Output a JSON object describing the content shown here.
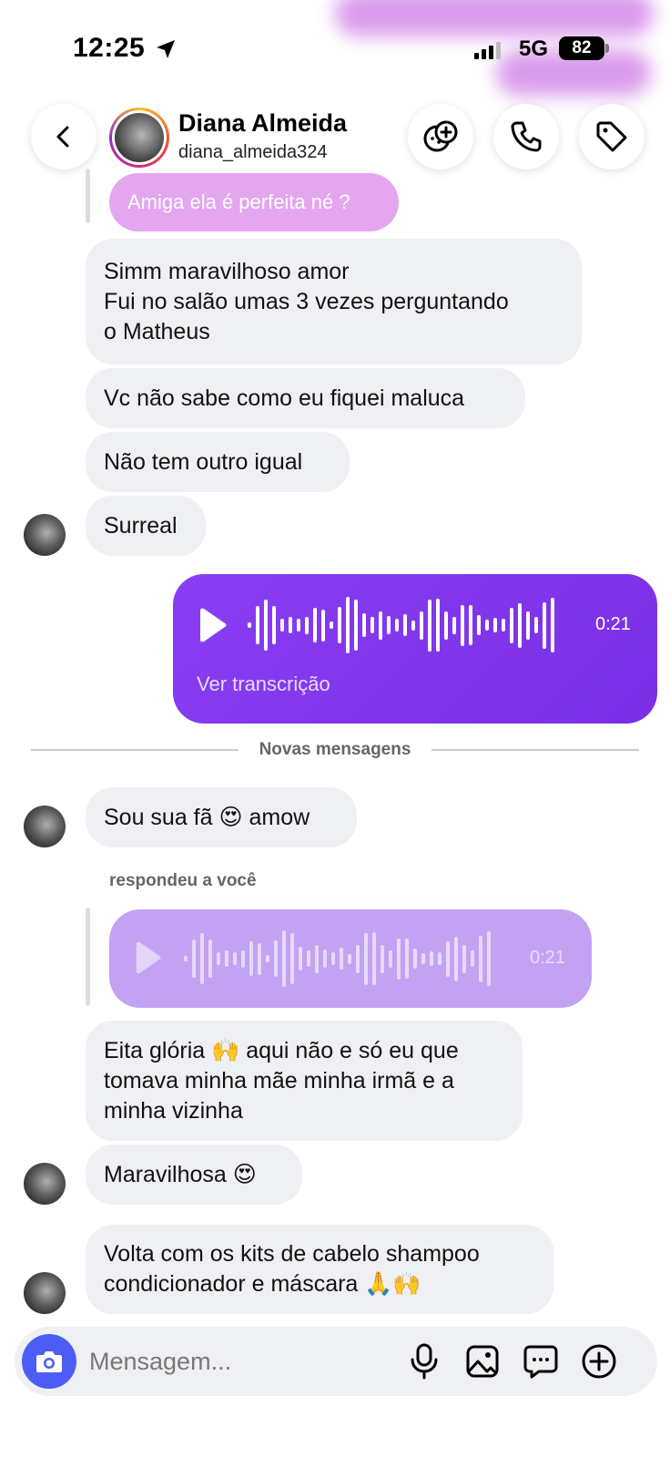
{
  "status_bar": {
    "time": "12:25",
    "network": "5G",
    "battery": "82"
  },
  "header": {
    "name": "Diana Almeida",
    "handle": "diana_almeida324",
    "icons": [
      "back-icon",
      "sticker-icon",
      "phone-icon",
      "tag-icon"
    ]
  },
  "messages": {
    "quoted_top": "Amiga ela é perfeita né ?",
    "m1_line1": "Simm maravilhoso amor",
    "m1_line2": "Fui no salão umas 3 vezes perguntando",
    "m1_line3": "o Matheus",
    "m2": "Vc não sabe como eu fiquei maluca",
    "m3": "Não tem outro igual",
    "m4": "Surreal",
    "voice_duration": "0:21",
    "voice_transcript": "Ver transcrição",
    "divider": "Novas mensagens",
    "m5": "Sou sua fã 😍 amow",
    "replied_label": "respondeu a você",
    "quoted_voice_duration": "0:21",
    "m6_line1": "Eita glória 🙌 aqui não e só eu que",
    "m6_line2": "tomava minha mãe minha irmã e a",
    "m6_line3": "minha vizinha",
    "m7": "Maravilhosa 😍",
    "m8_line1": "Volta com os kits de cabelo shampoo",
    "m8_line2": "condicionador e máscara 🙏🙌"
  },
  "composer": {
    "placeholder": "Mensagem...",
    "icons": [
      "camera-icon",
      "microphone-icon",
      "gallery-icon",
      "sticker-message-icon",
      "plus-icon"
    ]
  },
  "colors": {
    "accent": "#7d33ea",
    "bubble": "#eff0f3",
    "camera": "#4c5df5"
  }
}
